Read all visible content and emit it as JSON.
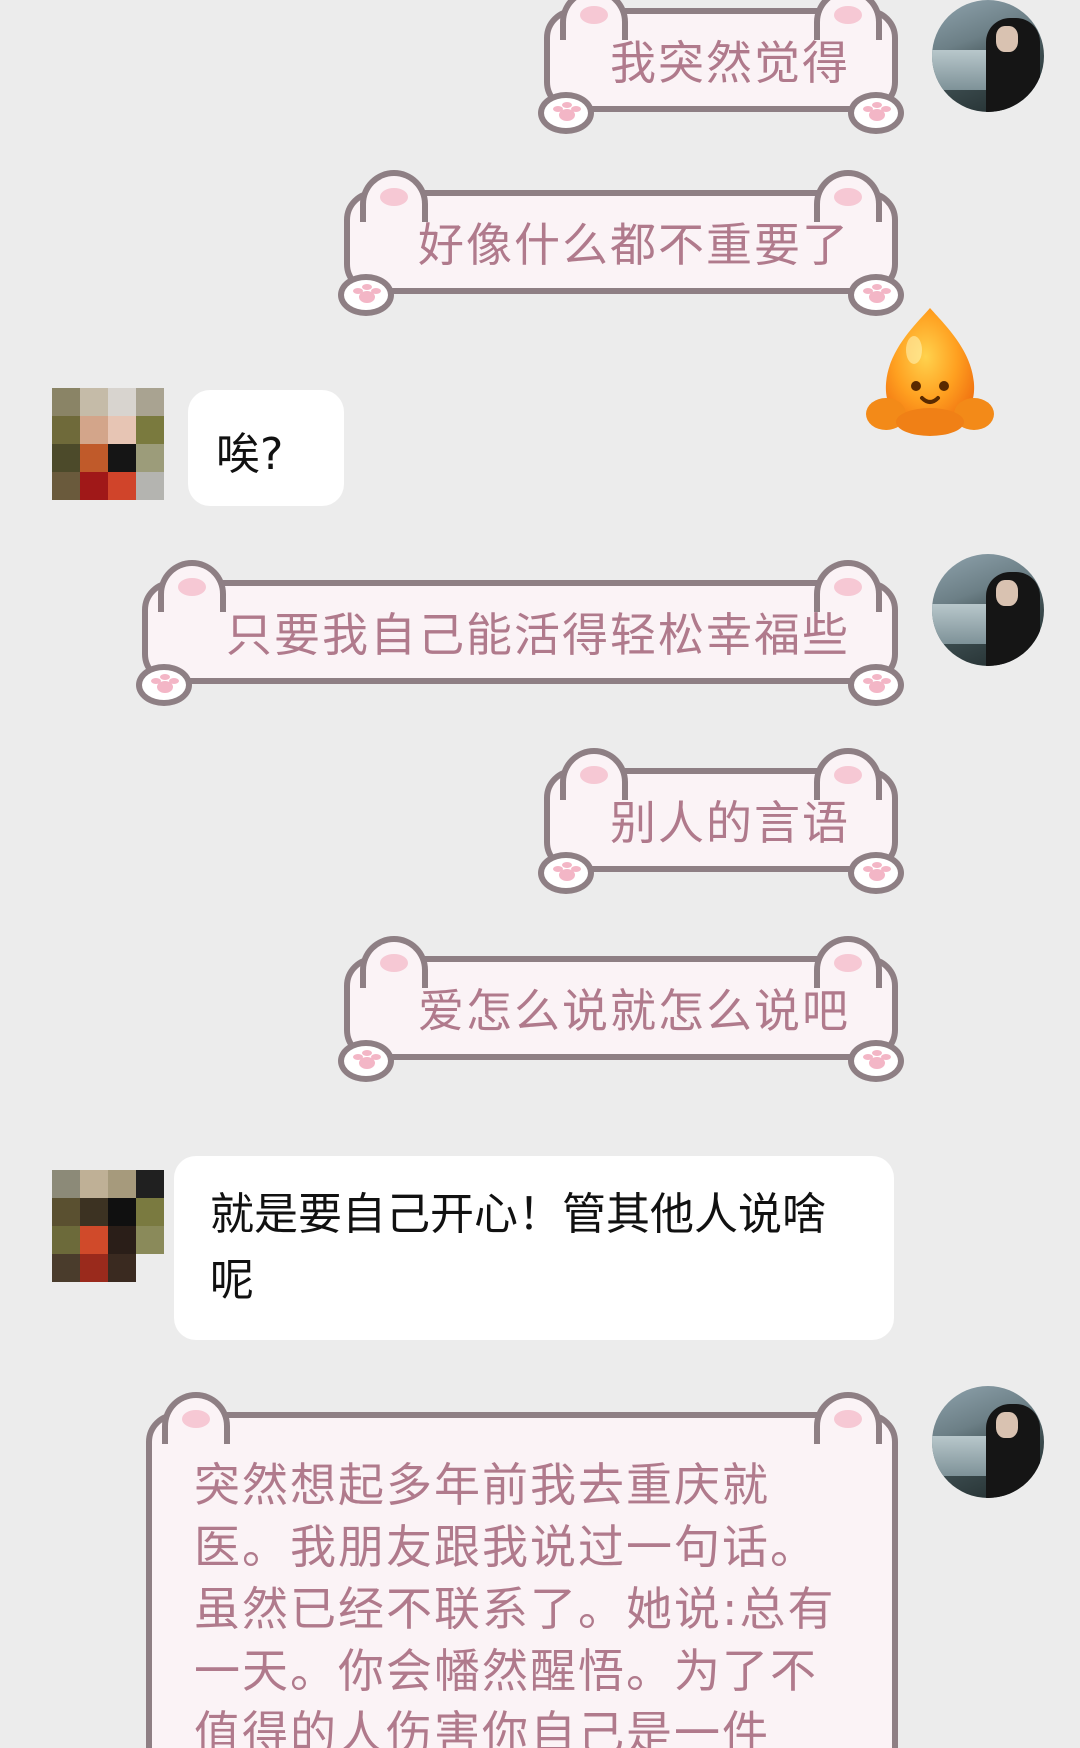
{
  "conversation": {
    "messages": [
      {
        "sender": "self",
        "style": "cat",
        "text": "我突然觉得"
      },
      {
        "sender": "self",
        "style": "cat",
        "text": "好像什么都不重要了"
      },
      {
        "sender": "self",
        "style": "sticker",
        "sticker": "orange-blob-smile-sticker"
      },
      {
        "sender": "other",
        "style": "plain",
        "text": "唉?"
      },
      {
        "sender": "self",
        "style": "cat",
        "text": "只要我自己能活得轻松幸福些"
      },
      {
        "sender": "self",
        "style": "cat",
        "text": "别人的言语"
      },
      {
        "sender": "self",
        "style": "cat",
        "text": "爱怎么说就怎么说吧"
      },
      {
        "sender": "other",
        "style": "plain",
        "text": "就是要自己开心！管其他人说啥呢"
      },
      {
        "sender": "self",
        "style": "cat",
        "text": "突然想起多年前我去重庆就医。我朋友跟我说过一句话。虽然已经不联系了。她说:总有一天。你会幡然醒悟。为了不值得的人伤害你自己是一件"
      }
    ]
  },
  "colors": {
    "background": "#ececec",
    "cat_outline": "#8e7f84",
    "cat_fill": "#fbf3f6",
    "cat_text": "#b07a8c",
    "ear_pink": "#f6c8d4",
    "plain_bubble": "#ffffff",
    "plain_text": "#111111",
    "sticker_orange": "#ff9a1f"
  }
}
